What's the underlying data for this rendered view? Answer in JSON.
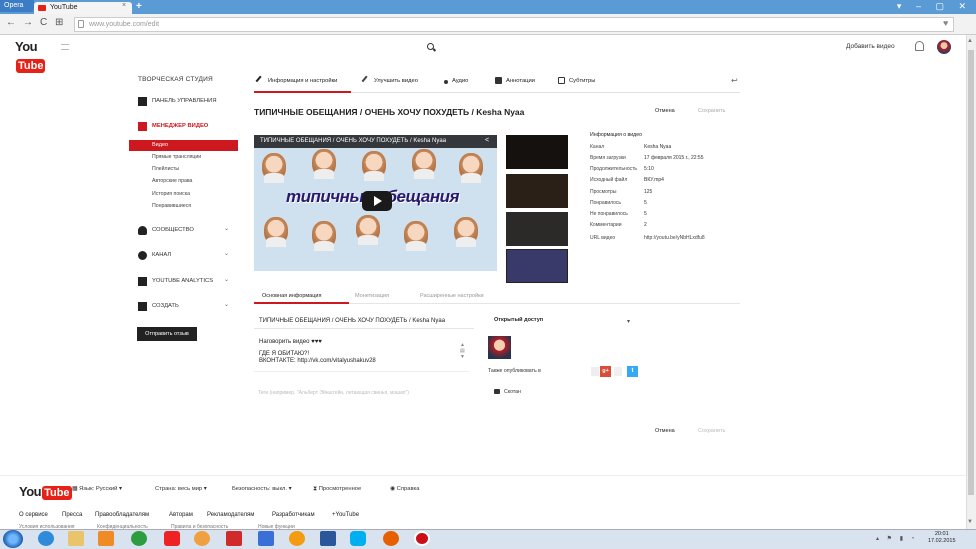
{
  "browser": {
    "menu_label": "Opera",
    "tab_title": "YouTube",
    "tab_close": "×",
    "new_tab": "+",
    "url": "www.youtube.com/edit",
    "nav_back": "←",
    "nav_forward": "→",
    "nav_reload": "C",
    "nav_home": "⊞",
    "window_controls": "▾ – ▢ ✕"
  },
  "header": {
    "logo_you": "You",
    "logo_tube": "Tube",
    "upload": "Добавить видео"
  },
  "sidebar": {
    "studio_title": "ТВОРЧЕСКАЯ СТУДИЯ",
    "dashboard": "ПАНЕЛЬ УПРАВЛЕНИЯ",
    "video_manager": "МЕНЕДЖЕР ВИДЕО",
    "video_manager_items": [
      "Видео",
      "Прямые трансляции",
      "Плейлисты",
      "Авторские права",
      "История поиска",
      "Понравившиеся"
    ],
    "community": "СООБЩЕСТВО",
    "channel": "КАНАЛ",
    "analytics": "YOUTUBE ANALYTICS",
    "create": "СОЗДАТЬ",
    "chevron": "⌄",
    "feedback": "Отправить отзыв"
  },
  "tabs": [
    "Информация и настройки",
    "Улучшить видео",
    "Аудио",
    "Аннотации",
    "Субтитры"
  ],
  "video": {
    "title": "ТИПИЧНЫЕ ОБЕЩАНИЯ / ОЧЕНЬ ХОЧУ ПОХУДЕТЬ / Kesha Nyaa",
    "cancel": "Отмена",
    "save": "Сохранить",
    "player_title": "ТИПИЧНЫЕ ОБЕЩАНИЯ / ОЧЕНЬ ХОЧУ ПОХУДЕТЬ / Kesha Nyaa",
    "player_overlay": "типичные обещания"
  },
  "meta": {
    "header": "Информация о видео",
    "rows": [
      {
        "label": "Канал",
        "value": "Kesha Nyaa"
      },
      {
        "label": "Время загрузки",
        "value": "17 февраля 2015 г., 22:55"
      },
      {
        "label": "Продолжительность",
        "value": "5:10"
      },
      {
        "label": "Исходный файл",
        "value": "ВКУ.mp4"
      },
      {
        "label": "Просмотры",
        "value": "125"
      },
      {
        "label": "Понравилось",
        "value": "5"
      },
      {
        "label": "Не понравилось",
        "value": "5"
      },
      {
        "label": "Комментарии",
        "value": "2"
      },
      {
        "label": "URL видео",
        "value": "http://youtu.be/yNbHLxdfu8"
      }
    ]
  },
  "subtabs": [
    "Основная информация",
    "Монетизация",
    "Расширенные настройки"
  ],
  "form": {
    "title_value": "ТИПИЧНЫЕ ОБЕЩАНИЯ / ОЧЕНЬ ХОЧУ ПОХУДЕТЬ / Kesha Nyaa",
    "desc_line1": "Наговорить видео ♥♥♥",
    "desc_line2": "ГДЕ Я ОБИТАЮ?!",
    "desc_line3": "ВКОНТАКТЕ: http://vk.com/vitalyushakuv28",
    "tags_placeholder": "Теги (например, \"Альберт Эйнштейн, летающая свинья, мэшап\")",
    "privacy": "Открытый доступ",
    "share_label": "Также опубликовать в",
    "gplus": "g+",
    "twitter": "t",
    "comments": "Скотан"
  },
  "footer": {
    "language": "Язык: Русский",
    "country": "Страна: весь мир",
    "safety": "Безопасность: выкл.",
    "history": "Просмотренное",
    "help": "Справка",
    "links": [
      "О сервисе",
      "Пресса",
      "Правообладателям",
      "Авторам",
      "Рекламодателям",
      "Разработчикам",
      "+YouTube"
    ],
    "links2": [
      "Условия использования",
      "Конфиденциальность",
      "Правила и безопасность",
      "Новые функции"
    ]
  },
  "taskbar": {
    "time": "20:01",
    "date": "17.02.2015",
    "tray": "▴ ⚑ ▮ ◔"
  },
  "colors": {
    "brand_red": "#cc181e",
    "youtube_red": "#e62117",
    "twitter_blue": "#33aaf3",
    "gplus_red": "#dd4b39"
  }
}
